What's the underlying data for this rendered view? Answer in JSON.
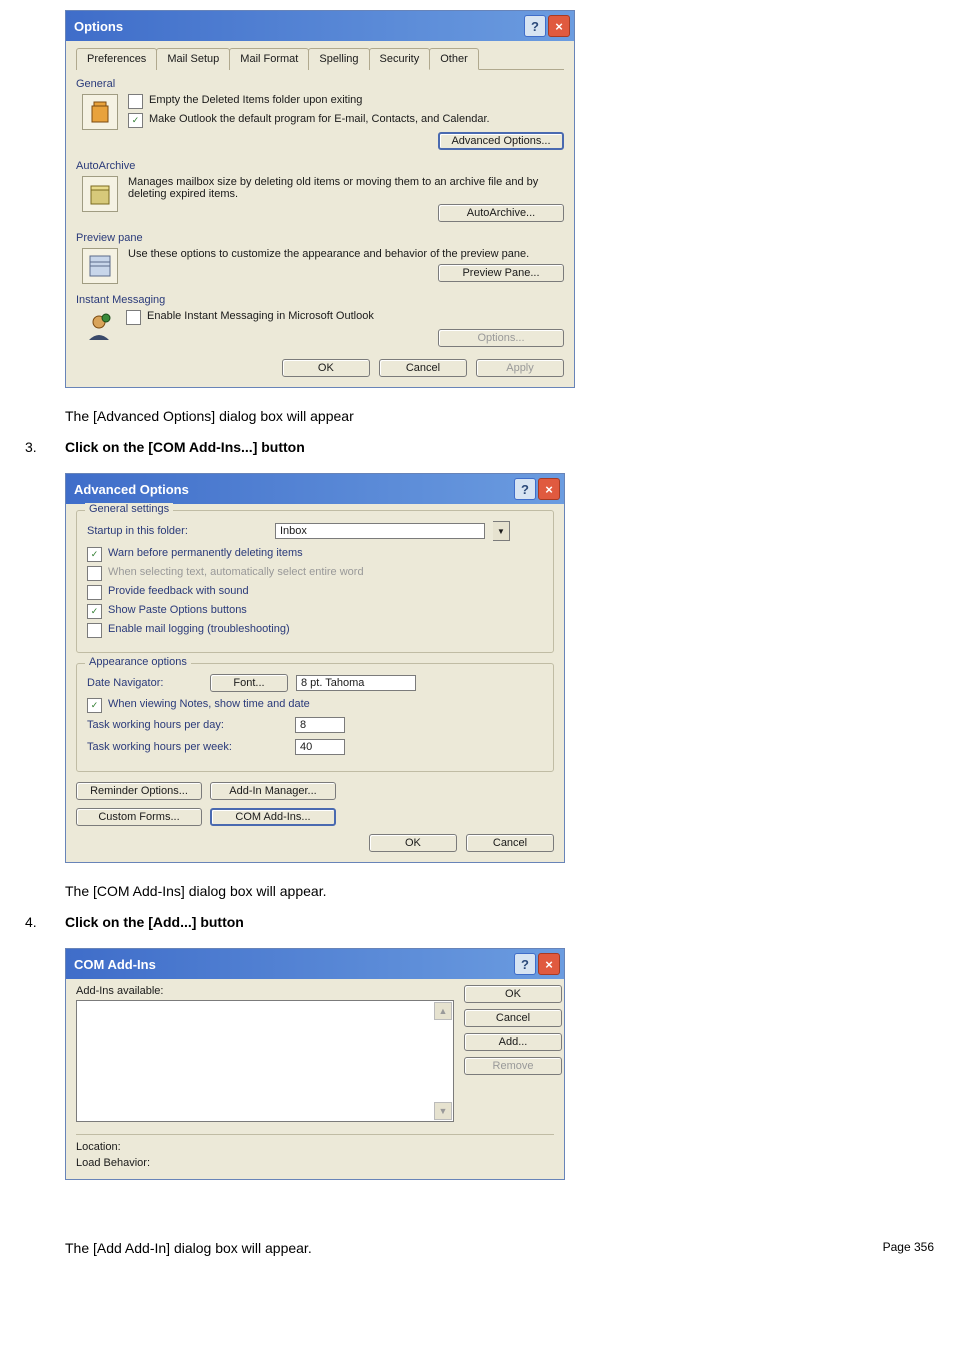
{
  "options_dialog": {
    "title": "Options",
    "tabs": [
      "Preferences",
      "Mail Setup",
      "Mail Format",
      "Spelling",
      "Security",
      "Other"
    ],
    "general": {
      "legend": "General",
      "empty_deleted": "Empty the Deleted Items folder upon exiting",
      "make_default": "Make Outlook the default program for E-mail, Contacts, and Calendar.",
      "advanced_btn": "Advanced Options..."
    },
    "autoarchive": {
      "legend": "AutoArchive",
      "desc": "Manages mailbox size by deleting old items or moving them to an archive file and by deleting expired items.",
      "btn": "AutoArchive..."
    },
    "preview": {
      "legend": "Preview pane",
      "desc": "Use these options to customize the appearance and behavior of the preview pane.",
      "btn": "Preview Pane..."
    },
    "im": {
      "legend": "Instant Messaging",
      "enable": "Enable Instant Messaging in Microsoft Outlook",
      "btn": "Options..."
    },
    "footer": {
      "ok": "OK",
      "cancel": "Cancel",
      "apply": "Apply"
    }
  },
  "text1": "The [Advanced Options] dialog box will appear",
  "step3_num": "3.",
  "step3_text": "Click on the [COM Add-Ins...] button",
  "advanced_dialog": {
    "title": "Advanced Options",
    "general": {
      "legend": "General settings",
      "startup_label": "Startup in this folder:",
      "startup_value": "Inbox",
      "warn": "Warn before permanently deleting items",
      "when_selecting": "When selecting text, automatically select entire word",
      "feedback": "Provide feedback with sound",
      "show_paste": "Show Paste Options buttons",
      "mail_logging": "Enable mail logging (troubleshooting)"
    },
    "appearance": {
      "legend": "Appearance options",
      "date_nav": "Date Navigator:",
      "font_btn": "Font...",
      "font_val": "8 pt. Tahoma",
      "when_viewing": "When viewing Notes, show time and date",
      "hours_day_lbl": "Task working hours per day:",
      "hours_day_val": "8",
      "hours_week_lbl": "Task working hours per week:",
      "hours_week_val": "40"
    },
    "reminder": "Reminder Options...",
    "addin_mgr": "Add-In Manager...",
    "custom_forms": "Custom Forms...",
    "com_addins": "COM Add-Ins...",
    "ok": "OK",
    "cancel": "Cancel"
  },
  "text2": "The [COM Add-Ins] dialog box will appear.",
  "step4_num": "4.",
  "step4_text": "Click on the [Add...] button",
  "com_dialog": {
    "title": "COM Add-Ins",
    "available": "Add-Ins available:",
    "ok": "OK",
    "cancel": "Cancel",
    "add": "Add...",
    "remove": "Remove",
    "location": "Location:",
    "behavior": "Load Behavior:"
  },
  "text3": "The [Add Add-In] dialog box will appear.",
  "page_label": "Page 356"
}
